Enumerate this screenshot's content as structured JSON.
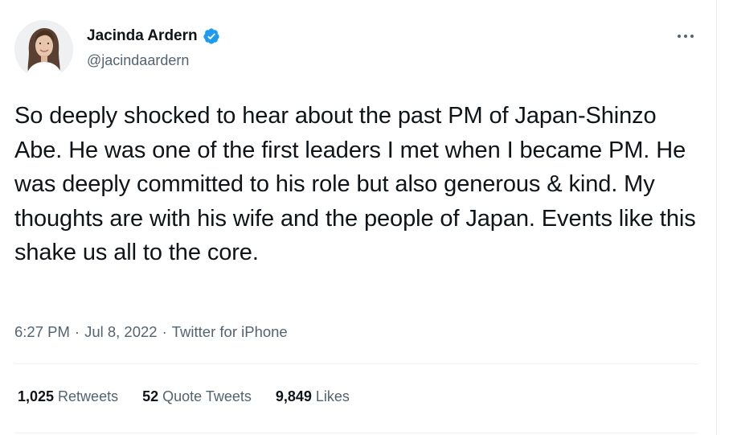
{
  "author": {
    "display_name": "Jacinda Ardern",
    "handle": "@jacindaardern",
    "verified": true
  },
  "tweet": {
    "text": "So deeply shocked to hear about the past PM of Japan-Shinzo Abe. He was one of the first leaders I met when I became PM. He was deeply committed to his role but also generous & kind. My thoughts are with his wife and the people of Japan. Events like this shake us all to the core.",
    "time": "6:27 PM",
    "date": "Jul 8, 2022",
    "source": "Twitter for iPhone"
  },
  "stats": {
    "retweets_count": "1,025",
    "retweets_label": "Retweets",
    "quotes_count": "52",
    "quotes_label": "Quote Tweets",
    "likes_count": "9,849",
    "likes_label": "Likes"
  },
  "colors": {
    "text_primary": "#0f1419",
    "text_secondary": "#536471",
    "verified_blue": "#1d9bf0",
    "divider": "#eff3f4"
  },
  "icons": {
    "verified": "verified-badge-icon",
    "more": "more-horizontal-icon"
  }
}
